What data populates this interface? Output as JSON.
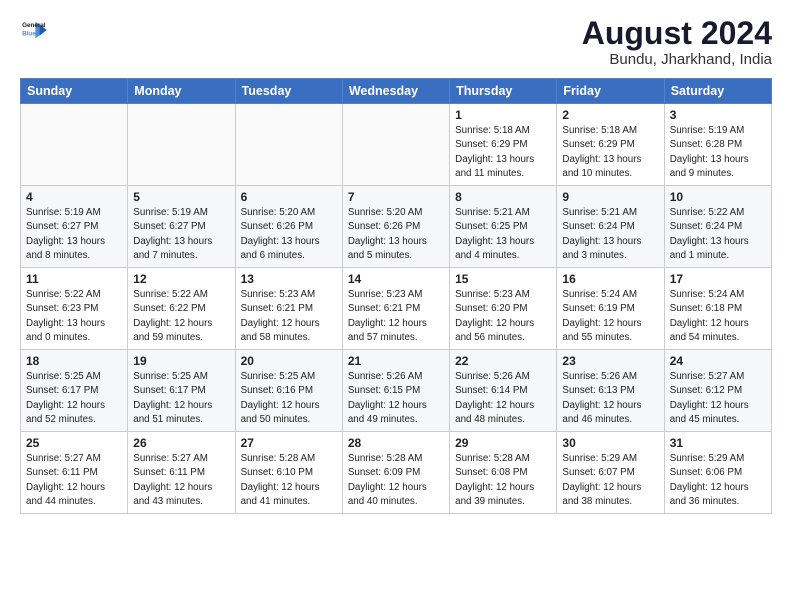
{
  "logo": {
    "line1": "General",
    "line2": "Blue"
  },
  "title": "August 2024",
  "location": "Bundu, Jharkhand, India",
  "weekdays": [
    "Sunday",
    "Monday",
    "Tuesday",
    "Wednesday",
    "Thursday",
    "Friday",
    "Saturday"
  ],
  "weeks": [
    [
      {
        "day": "",
        "text": ""
      },
      {
        "day": "",
        "text": ""
      },
      {
        "day": "",
        "text": ""
      },
      {
        "day": "",
        "text": ""
      },
      {
        "day": "1",
        "text": "Sunrise: 5:18 AM\nSunset: 6:29 PM\nDaylight: 13 hours\nand 11 minutes."
      },
      {
        "day": "2",
        "text": "Sunrise: 5:18 AM\nSunset: 6:29 PM\nDaylight: 13 hours\nand 10 minutes."
      },
      {
        "day": "3",
        "text": "Sunrise: 5:19 AM\nSunset: 6:28 PM\nDaylight: 13 hours\nand 9 minutes."
      }
    ],
    [
      {
        "day": "4",
        "text": "Sunrise: 5:19 AM\nSunset: 6:27 PM\nDaylight: 13 hours\nand 8 minutes."
      },
      {
        "day": "5",
        "text": "Sunrise: 5:19 AM\nSunset: 6:27 PM\nDaylight: 13 hours\nand 7 minutes."
      },
      {
        "day": "6",
        "text": "Sunrise: 5:20 AM\nSunset: 6:26 PM\nDaylight: 13 hours\nand 6 minutes."
      },
      {
        "day": "7",
        "text": "Sunrise: 5:20 AM\nSunset: 6:26 PM\nDaylight: 13 hours\nand 5 minutes."
      },
      {
        "day": "8",
        "text": "Sunrise: 5:21 AM\nSunset: 6:25 PM\nDaylight: 13 hours\nand 4 minutes."
      },
      {
        "day": "9",
        "text": "Sunrise: 5:21 AM\nSunset: 6:24 PM\nDaylight: 13 hours\nand 3 minutes."
      },
      {
        "day": "10",
        "text": "Sunrise: 5:22 AM\nSunset: 6:24 PM\nDaylight: 13 hours\nand 1 minute."
      }
    ],
    [
      {
        "day": "11",
        "text": "Sunrise: 5:22 AM\nSunset: 6:23 PM\nDaylight: 13 hours\nand 0 minutes."
      },
      {
        "day": "12",
        "text": "Sunrise: 5:22 AM\nSunset: 6:22 PM\nDaylight: 12 hours\nand 59 minutes."
      },
      {
        "day": "13",
        "text": "Sunrise: 5:23 AM\nSunset: 6:21 PM\nDaylight: 12 hours\nand 58 minutes."
      },
      {
        "day": "14",
        "text": "Sunrise: 5:23 AM\nSunset: 6:21 PM\nDaylight: 12 hours\nand 57 minutes."
      },
      {
        "day": "15",
        "text": "Sunrise: 5:23 AM\nSunset: 6:20 PM\nDaylight: 12 hours\nand 56 minutes."
      },
      {
        "day": "16",
        "text": "Sunrise: 5:24 AM\nSunset: 6:19 PM\nDaylight: 12 hours\nand 55 minutes."
      },
      {
        "day": "17",
        "text": "Sunrise: 5:24 AM\nSunset: 6:18 PM\nDaylight: 12 hours\nand 54 minutes."
      }
    ],
    [
      {
        "day": "18",
        "text": "Sunrise: 5:25 AM\nSunset: 6:17 PM\nDaylight: 12 hours\nand 52 minutes."
      },
      {
        "day": "19",
        "text": "Sunrise: 5:25 AM\nSunset: 6:17 PM\nDaylight: 12 hours\nand 51 minutes."
      },
      {
        "day": "20",
        "text": "Sunrise: 5:25 AM\nSunset: 6:16 PM\nDaylight: 12 hours\nand 50 minutes."
      },
      {
        "day": "21",
        "text": "Sunrise: 5:26 AM\nSunset: 6:15 PM\nDaylight: 12 hours\nand 49 minutes."
      },
      {
        "day": "22",
        "text": "Sunrise: 5:26 AM\nSunset: 6:14 PM\nDaylight: 12 hours\nand 48 minutes."
      },
      {
        "day": "23",
        "text": "Sunrise: 5:26 AM\nSunset: 6:13 PM\nDaylight: 12 hours\nand 46 minutes."
      },
      {
        "day": "24",
        "text": "Sunrise: 5:27 AM\nSunset: 6:12 PM\nDaylight: 12 hours\nand 45 minutes."
      }
    ],
    [
      {
        "day": "25",
        "text": "Sunrise: 5:27 AM\nSunset: 6:11 PM\nDaylight: 12 hours\nand 44 minutes."
      },
      {
        "day": "26",
        "text": "Sunrise: 5:27 AM\nSunset: 6:11 PM\nDaylight: 12 hours\nand 43 minutes."
      },
      {
        "day": "27",
        "text": "Sunrise: 5:28 AM\nSunset: 6:10 PM\nDaylight: 12 hours\nand 41 minutes."
      },
      {
        "day": "28",
        "text": "Sunrise: 5:28 AM\nSunset: 6:09 PM\nDaylight: 12 hours\nand 40 minutes."
      },
      {
        "day": "29",
        "text": "Sunrise: 5:28 AM\nSunset: 6:08 PM\nDaylight: 12 hours\nand 39 minutes."
      },
      {
        "day": "30",
        "text": "Sunrise: 5:29 AM\nSunset: 6:07 PM\nDaylight: 12 hours\nand 38 minutes."
      },
      {
        "day": "31",
        "text": "Sunrise: 5:29 AM\nSunset: 6:06 PM\nDaylight: 12 hours\nand 36 minutes."
      }
    ]
  ]
}
